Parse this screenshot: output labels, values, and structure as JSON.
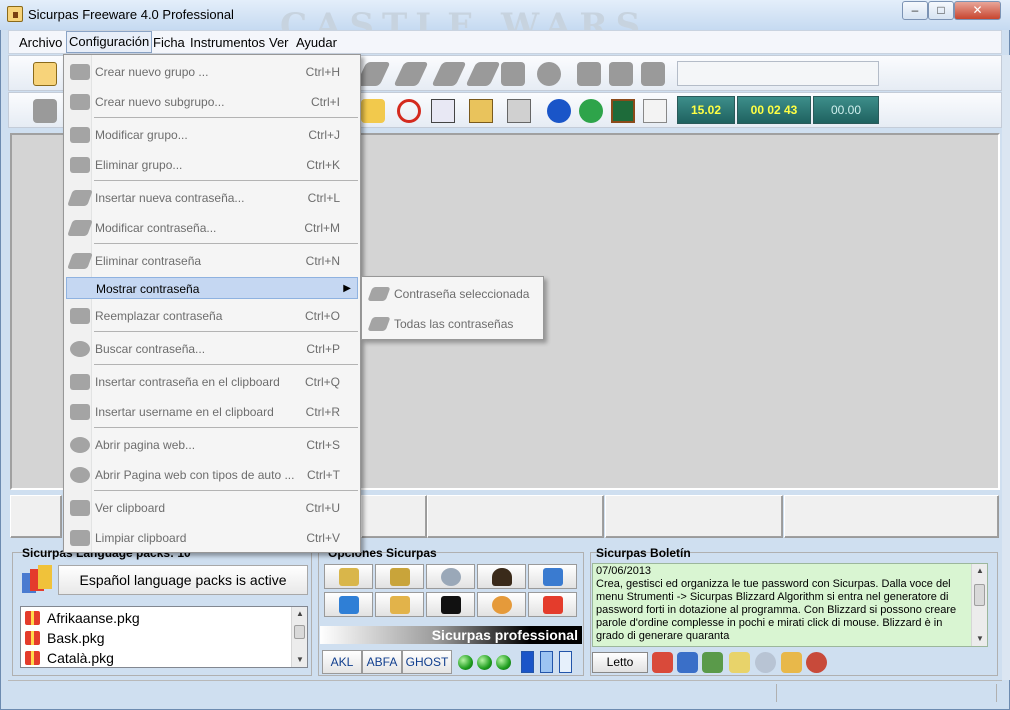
{
  "window": {
    "title": "Sicurpas Freeware 4.0 Professional",
    "background_logo": "CASTLE WARS",
    "controls": {
      "minimize": "–",
      "maximize": "□",
      "close": "✕"
    }
  },
  "menubar": {
    "items": [
      "Archivo",
      "Configuración",
      "Ficha",
      "Instrumentos",
      "Ver",
      "Ayudar"
    ],
    "open_menu": "Configuración"
  },
  "toolbar": {
    "search_value": "",
    "counter_1": "15.02",
    "counter_2": "00 02 43",
    "counter_3": "00.00"
  },
  "dropdown": {
    "items": [
      {
        "label": "Crear nuevo grupo ...",
        "shortcut": "Ctrl+H",
        "icon": "folder-icon"
      },
      {
        "label": "Crear nuevo subgrupo...",
        "shortcut": "Ctrl+I",
        "icon": "folder-open-icon"
      },
      {
        "label": "Modificar grupo...",
        "shortcut": "Ctrl+J",
        "icon": "folder-edit-icon"
      },
      {
        "label": "Eliminar grupo...",
        "shortcut": "Ctrl+K",
        "icon": "folder-delete-icon"
      },
      {
        "label": "Insertar nueva contraseña...",
        "shortcut": "Ctrl+L",
        "icon": "key-add-icon"
      },
      {
        "label": "Modificar contraseña...",
        "shortcut": "Ctrl+M",
        "icon": "key-edit-icon"
      },
      {
        "label": "Eliminar contraseña",
        "shortcut": "Ctrl+N",
        "icon": "key-delete-icon"
      },
      {
        "label": "Mostrar contraseña",
        "shortcut": "",
        "icon": ""
      },
      {
        "label": "Reemplazar contraseña",
        "shortcut": "Ctrl+O",
        "icon": "swap-icon"
      },
      {
        "label": "Buscar contraseña...",
        "shortcut": "Ctrl+P",
        "icon": "search-person-icon"
      },
      {
        "label": "Insertar contraseña en el clipboard",
        "shortcut": "Ctrl+Q",
        "icon": "clipboard-icon"
      },
      {
        "label": "Insertar username en el clipboard",
        "shortcut": "Ctrl+R",
        "icon": "clipboard-user-icon"
      },
      {
        "label": "Abrir pagina web...",
        "shortcut": "Ctrl+S",
        "icon": "globe-icon"
      },
      {
        "label": "Abrir Pagina web con tipos de auto ...",
        "shortcut": "Ctrl+T",
        "icon": "globe-auto-icon"
      },
      {
        "label": "Ver clipboard",
        "shortcut": "Ctrl+U",
        "icon": "clipboard-view-icon"
      },
      {
        "label": "Limpiar clipboard",
        "shortcut": "Ctrl+V",
        "icon": "clipboard-clear-icon"
      }
    ],
    "submenu_arrow": "▶"
  },
  "submenu": {
    "items": [
      "Contraseña seleccionada",
      "Todas las contraseñas"
    ]
  },
  "language_panel": {
    "title": "Sicurpas Language packs: 10",
    "active_button": "Español language packs is active",
    "packages": [
      "Afrikaanse.pkg",
      "Bask.pkg",
      "Català.pkg"
    ]
  },
  "options_panel": {
    "title": "Opciones Sicurpas",
    "banner": "Sicurpas professional",
    "mode_buttons": [
      "AKL",
      "ABFA",
      "GHOST"
    ]
  },
  "bulletin": {
    "title": "Sicurpas Boletín",
    "date": "07/06/2013",
    "text": "Crea, gestisci ed organizza le tue password con Sicurpas. Dalla voce del menu Strumenti -> Sicurpas Blizzard Algorithm si entra nel generatore di password forti in dotazione al programma. Con Blizzard si possono creare parole d'ordine complesse in pochi e mirati click di mouse. Blizzard è in grado di generare quaranta",
    "read_button": "Letto"
  },
  "colors": {
    "lcd_text": "#ffff44",
    "lcd_bg": "#2f7a77",
    "menu_highlight": "#c5d7f2",
    "bulletin_bg": "#d9f5d2"
  }
}
